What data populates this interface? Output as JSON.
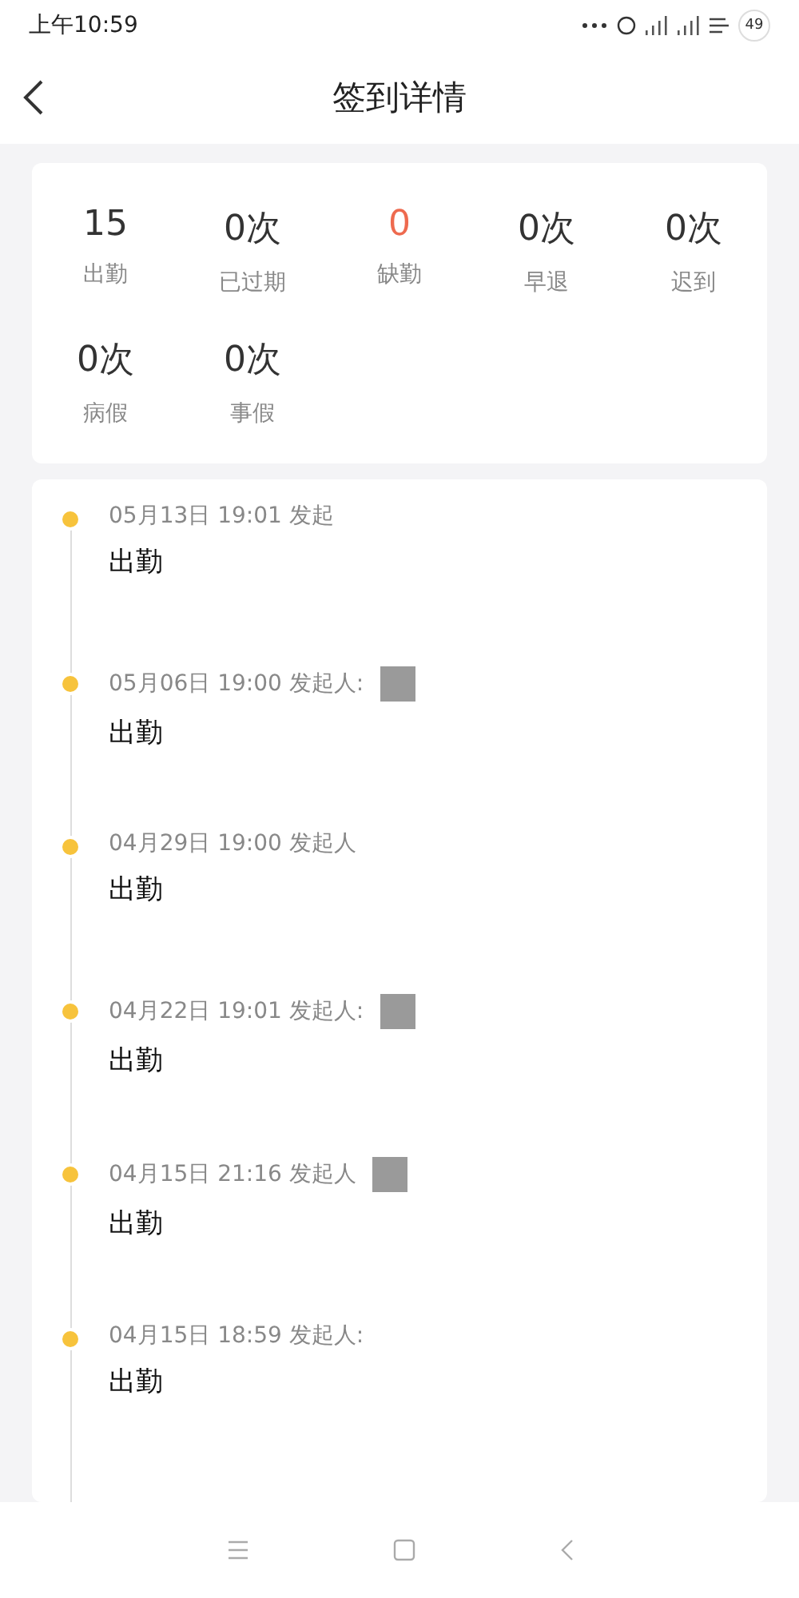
{
  "status_bar": {
    "time": "上午10:59",
    "battery": "49"
  },
  "header": {
    "title": "签到详情"
  },
  "stats": [
    {
      "value": "15",
      "label": "出勤",
      "highlighted": false
    },
    {
      "value": "0次",
      "label": "已过期",
      "highlighted": false
    },
    {
      "value": "0",
      "label": "缺勤",
      "highlighted": true
    },
    {
      "value": "0次",
      "label": "早退",
      "highlighted": false
    },
    {
      "value": "0次",
      "label": "迟到",
      "highlighted": false
    },
    {
      "value": "0次",
      "label": "病假",
      "highlighted": false
    },
    {
      "value": "0次",
      "label": "事假",
      "highlighted": false
    }
  ],
  "timeline": [
    {
      "time": "05月13日 19:01 发起",
      "status": "出勤",
      "redacted": false
    },
    {
      "time": "05月06日 19:00 发起人:",
      "status": "出勤",
      "redacted": true
    },
    {
      "time": "04月29日 19:00 发起人",
      "status": "出勤",
      "redacted": false
    },
    {
      "time": "04月22日 19:01 发起人:",
      "status": "出勤",
      "redacted": true
    },
    {
      "time": "04月15日 21:16 发起人",
      "status": "出勤",
      "redacted": true
    },
    {
      "time": "04月15日 18:59 发起人:",
      "status": "出勤",
      "redacted": false
    }
  ]
}
